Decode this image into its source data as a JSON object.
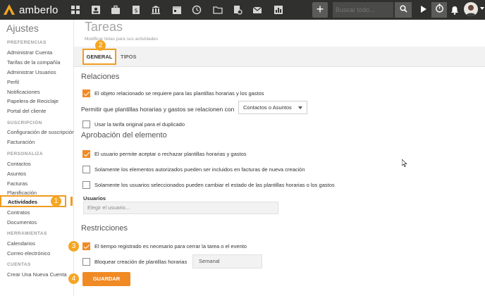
{
  "app": {
    "logo_text": "amberlo"
  },
  "topbar": {
    "nav_icons": [
      "dashboard-icon",
      "contacts-icon",
      "briefcase-icon",
      "billing-icon",
      "bank-icon",
      "calendar-icon",
      "timer-history-icon",
      "folder-icon",
      "document-settings-icon",
      "mail-icon",
      "reports-icon"
    ],
    "plus_label": "+",
    "search_placeholder": "Buscar todo..."
  },
  "sidebar": {
    "title": "Ajustes",
    "sections": [
      {
        "label": "PREFERENCIAS",
        "items": [
          "Administrar Cuenta",
          "Tarifas de la compañía",
          "Administrar Usuarios",
          "Perfil",
          "Notificaciones",
          "Papelera de Reciclaje",
          "Portal del cliente"
        ]
      },
      {
        "label": "SUSCRIPCIÓN",
        "items": [
          "Configuración de suscripción",
          "Facturación"
        ]
      },
      {
        "label": "PERSONALIZA",
        "items": [
          "Contactos",
          "Asuntos",
          "Facturas",
          "Planificación",
          "Actividades",
          "Contratos",
          "Documentos"
        ]
      },
      {
        "label": "HERRAMIENTAS",
        "items": [
          "Calendarios",
          "Correo electrónico"
        ]
      },
      {
        "label": "CUENTAS",
        "items": [
          "Crear Una Nueva Cuenta"
        ]
      }
    ],
    "active_item": "Actividades"
  },
  "main": {
    "title": "Tareas",
    "subtitle": "Modificar listas para sus actividades",
    "tabs": [
      {
        "label": "GENERAL",
        "active": true
      },
      {
        "label": "TIPOS",
        "active": false
      }
    ],
    "relaciones": {
      "heading": "Relaciones",
      "cb_required": {
        "label": "El objeto relacionado se requiere para las plantillas horarias y los gastos",
        "checked": true
      },
      "allow_label": "Permitir que plantillas horarias y gastos se relacionen con",
      "allow_select": "Contactos o Asuntos",
      "cb_original_rate": {
        "label": "Usar la tarifa original para el duplicado",
        "checked": false
      }
    },
    "aprobacion": {
      "heading": "Aprobación del elemento",
      "cb_user_accept": {
        "label": "El usuario permite aceptar o rechazar plantillas horarias y gastos",
        "checked": true
      },
      "cb_authorized": {
        "label": "Solamente los elementos autorizados pueden ser incluidos en facturas de nueva creación",
        "checked": false
      },
      "cb_selected_users": {
        "label": "Solamente los usuarios seleccionados pueden cambiar el estado de las plantillas horarias o los gastos",
        "checked": false
      },
      "users_label": "Usuarios",
      "users_placeholder": "Elegir el usuario..."
    },
    "restricciones": {
      "heading": "Restricciones",
      "cb_time_required": {
        "label": "El tiempo registrado es necesario para cerrar la tarea o el evento",
        "checked": true
      },
      "cb_block_creation": {
        "label": "Bloquear creación de plantillas horarias",
        "checked": false
      },
      "block_select": "Semanal"
    },
    "save_label": "GUARDAR"
  },
  "badges": [
    "1",
    "2",
    "3",
    "4"
  ],
  "colors": {
    "accent": "#f08a24",
    "highlight": "#f5a623",
    "topbar": "#30312f"
  }
}
